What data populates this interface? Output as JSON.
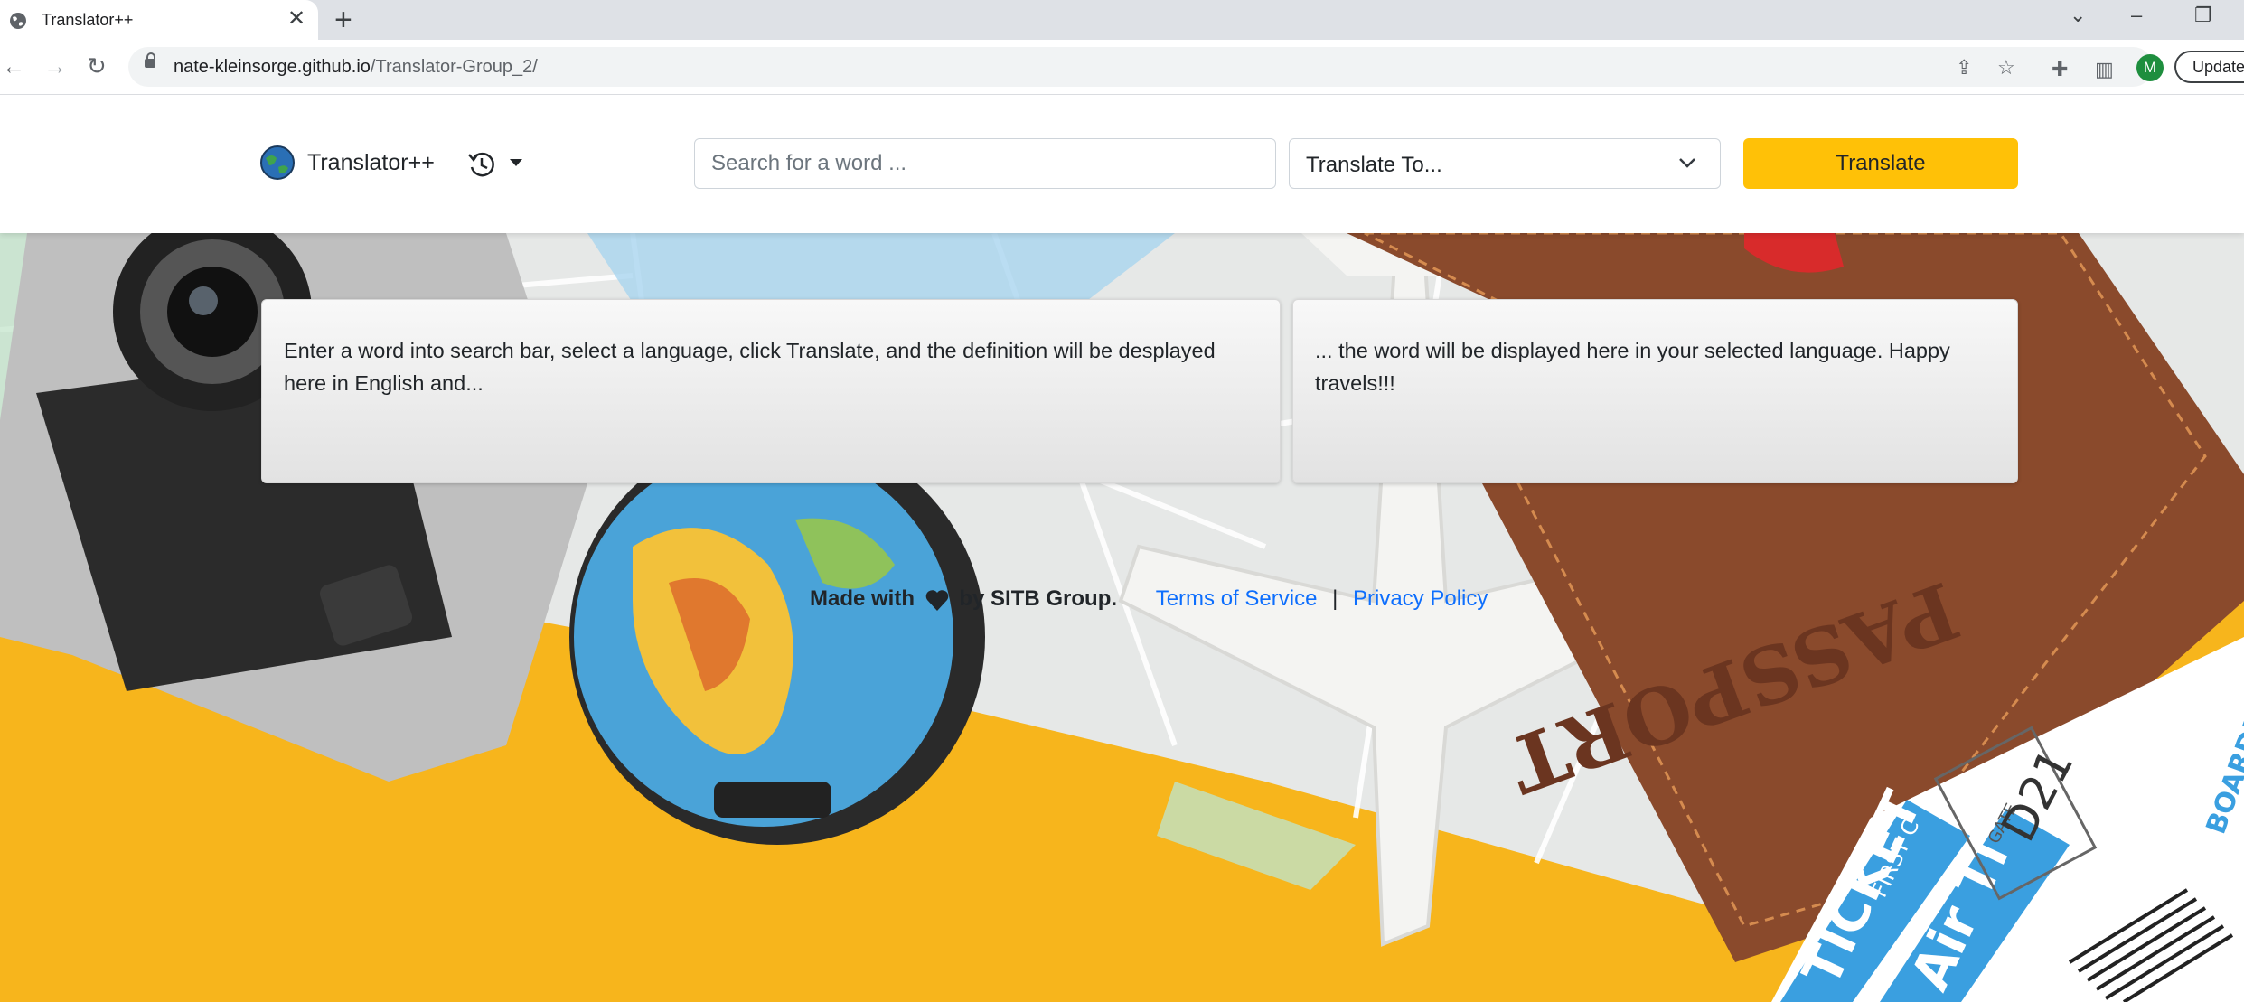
{
  "browser": {
    "tab_title": "Translator++",
    "tab_close": "✕",
    "new_tab": "+",
    "url_host": "nate-kleinsorge.github.io",
    "url_path": "/Translator-Group_2/",
    "profile_initial": "M",
    "update_label": "Update"
  },
  "navbar": {
    "brand": "Translator++",
    "search_placeholder": "Search for a word ...",
    "select_value": "Translate To...",
    "translate_label": "Translate",
    "accent_color": "#ffc107"
  },
  "cards": {
    "left_text": "Enter a word into search bar, select a language, click Translate, and the definition will be desplayed here in English and...",
    "right_text": "... the word will be displayed here in your selected language. Happy travels!!!"
  },
  "footer": {
    "made_prefix": "Made with",
    "made_suffix": "by SITB Group.",
    "terms": "Terms of Service",
    "separator": "|",
    "privacy": "Privacy Policy"
  },
  "scene_text": {
    "passport": "PASSPORT",
    "ticket": "TICKET",
    "air": "Air Ti",
    "first": "FIRST C",
    "gate": "GATE",
    "gate_no": "D21",
    "boarding": "BOARDI"
  }
}
